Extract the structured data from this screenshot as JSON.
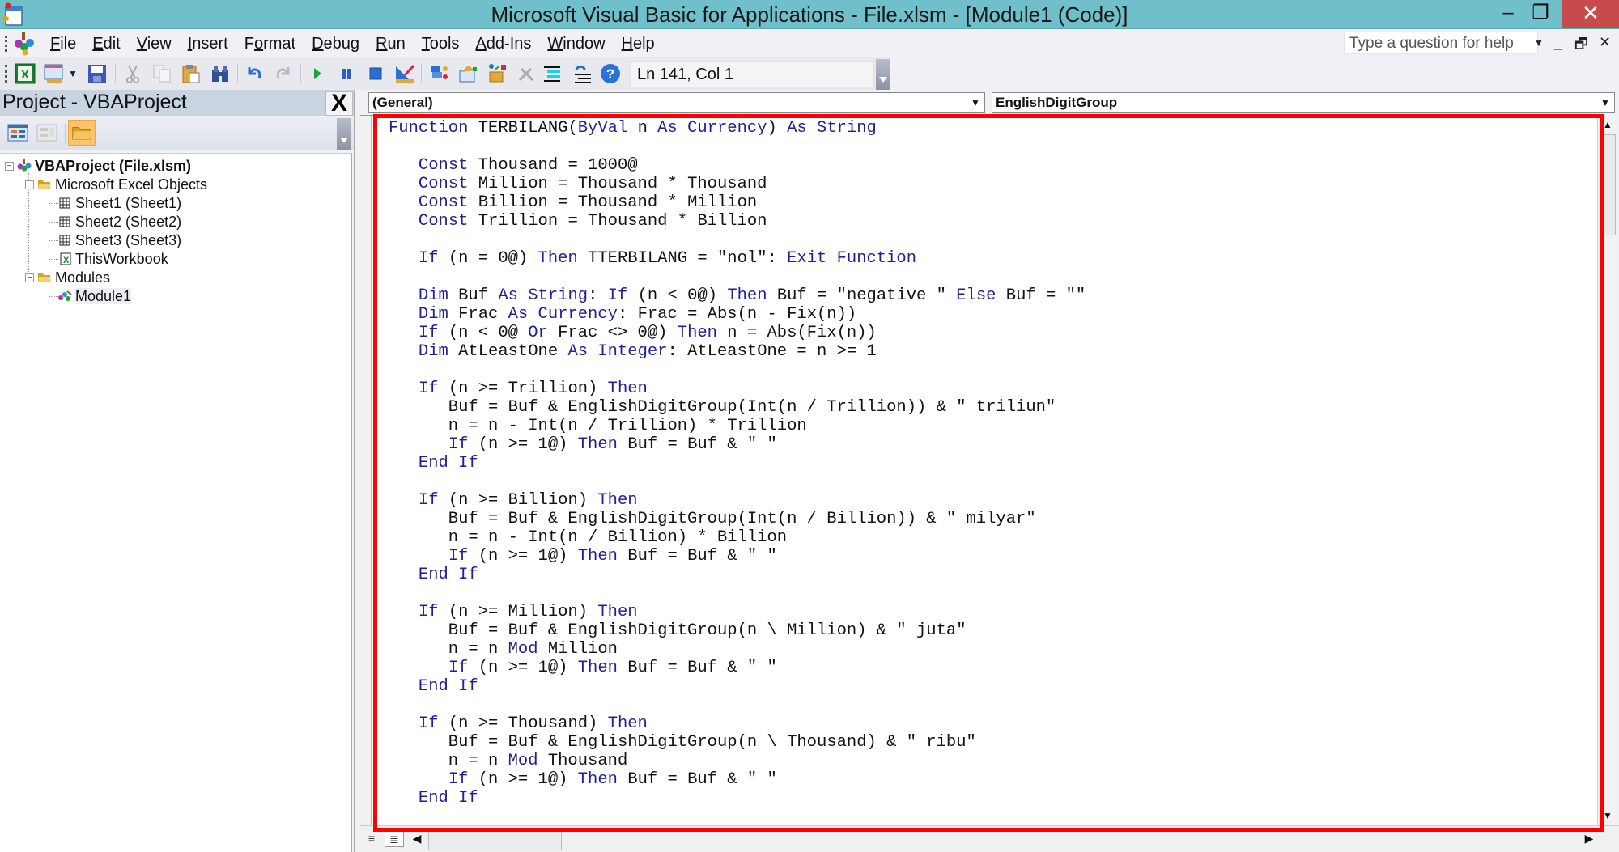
{
  "window": {
    "title": "Microsoft Visual Basic for Applications - File.xlsm - [Module1 (Code)]",
    "controls": {
      "minimize": "–",
      "maximize": "❐",
      "close": "✕"
    }
  },
  "menubar": {
    "items": [
      {
        "pre": "",
        "ul": "F",
        "post": "ile"
      },
      {
        "pre": "",
        "ul": "E",
        "post": "dit"
      },
      {
        "pre": "",
        "ul": "V",
        "post": "iew"
      },
      {
        "pre": "",
        "ul": "I",
        "post": "nsert"
      },
      {
        "pre": "F",
        "ul": "o",
        "post": "rmat"
      },
      {
        "pre": "",
        "ul": "D",
        "post": "ebug"
      },
      {
        "pre": "",
        "ul": "R",
        "post": "un"
      },
      {
        "pre": "",
        "ul": "T",
        "post": "ools"
      },
      {
        "pre": "",
        "ul": "A",
        "post": "dd-Ins"
      },
      {
        "pre": "",
        "ul": "W",
        "post": "indow"
      },
      {
        "pre": "",
        "ul": "H",
        "post": "elp"
      }
    ],
    "help_placeholder": "Type a question for help",
    "mdi": {
      "minimize": "_",
      "restore": "🗗",
      "close": "✕"
    }
  },
  "toolbar": {
    "buttons": [
      "view-excel",
      "insert-userform",
      "insert-dropdown",
      "save",
      "cut",
      "copy",
      "paste",
      "find",
      "undo",
      "redo",
      "run",
      "break",
      "reset",
      "design-mode",
      "project-explorer",
      "properties-window",
      "object-browser",
      "toolbox",
      "indent",
      "outdent",
      "help"
    ],
    "cursor_position": "Ln 141, Col 1"
  },
  "project_pane": {
    "title": "Project - VBAProject",
    "close_label": "X",
    "buttons": [
      "view-code",
      "view-object",
      "toggle-folders"
    ],
    "tree": [
      {
        "label": "VBAProject (File.xlsm)",
        "level": 0,
        "icon": "project",
        "bold": true
      },
      {
        "label": "Microsoft Excel Objects",
        "level": 1,
        "icon": "folder"
      },
      {
        "label": "Sheet1 (Sheet1)",
        "level": 2,
        "icon": "sheet"
      },
      {
        "label": "Sheet2 (Sheet2)",
        "level": 2,
        "icon": "sheet"
      },
      {
        "label": "Sheet3 (Sheet3)",
        "level": 2,
        "icon": "sheet"
      },
      {
        "label": "ThisWorkbook",
        "level": 2,
        "icon": "workbook"
      },
      {
        "label": "Modules",
        "level": 1,
        "icon": "folder"
      },
      {
        "label": "Module1",
        "level": 2,
        "icon": "module",
        "selected": true
      }
    ]
  },
  "code_pane": {
    "object_combo": "(General)",
    "procedure_combo": "EnglishDigitGroup",
    "highlight_color": "#ff0000",
    "keyword_color": "#1f1f9c",
    "lines": [
      [
        [
          "k",
          "Function"
        ],
        [
          "t",
          " TERBILANG("
        ],
        [
          "k",
          "ByVal"
        ],
        [
          "t",
          " n "
        ],
        [
          "k",
          "As"
        ],
        [
          "t",
          " "
        ],
        [
          "k",
          "Currency"
        ],
        [
          "t",
          ") "
        ],
        [
          "k",
          "As"
        ],
        [
          "t",
          " "
        ],
        [
          "k",
          "String"
        ]
      ],
      [],
      [
        [
          "t",
          "   "
        ],
        [
          "k",
          "Const"
        ],
        [
          "t",
          " Thousand = 1000@"
        ]
      ],
      [
        [
          "t",
          "   "
        ],
        [
          "k",
          "Const"
        ],
        [
          "t",
          " Million = Thousand * Thousand"
        ]
      ],
      [
        [
          "t",
          "   "
        ],
        [
          "k",
          "Const"
        ],
        [
          "t",
          " Billion = Thousand * Million"
        ]
      ],
      [
        [
          "t",
          "   "
        ],
        [
          "k",
          "Const"
        ],
        [
          "t",
          " Trillion = Thousand * Billion"
        ]
      ],
      [],
      [
        [
          "t",
          "   "
        ],
        [
          "k",
          "If"
        ],
        [
          "t",
          " (n = 0@) "
        ],
        [
          "k",
          "Then"
        ],
        [
          "t",
          " TTERBILANG = \"nol\": "
        ],
        [
          "k",
          "Exit Function"
        ]
      ],
      [],
      [
        [
          "t",
          "   "
        ],
        [
          "k",
          "Dim"
        ],
        [
          "t",
          " Buf "
        ],
        [
          "k",
          "As"
        ],
        [
          "t",
          " "
        ],
        [
          "k",
          "String"
        ],
        [
          "t",
          ": "
        ],
        [
          "k",
          "If"
        ],
        [
          "t",
          " (n < 0@) "
        ],
        [
          "k",
          "Then"
        ],
        [
          "t",
          " Buf = \"negative \" "
        ],
        [
          "k",
          "Else"
        ],
        [
          "t",
          " Buf = \"\""
        ]
      ],
      [
        [
          "t",
          "   "
        ],
        [
          "k",
          "Dim"
        ],
        [
          "t",
          " Frac "
        ],
        [
          "k",
          "As"
        ],
        [
          "t",
          " "
        ],
        [
          "k",
          "Currency"
        ],
        [
          "t",
          ": Frac = Abs(n - Fix(n))"
        ]
      ],
      [
        [
          "t",
          "   "
        ],
        [
          "k",
          "If"
        ],
        [
          "t",
          " (n < 0@ "
        ],
        [
          "k",
          "Or"
        ],
        [
          "t",
          " Frac <> 0@) "
        ],
        [
          "k",
          "Then"
        ],
        [
          "t",
          " n = Abs(Fix(n))"
        ]
      ],
      [
        [
          "t",
          "   "
        ],
        [
          "k",
          "Dim"
        ],
        [
          "t",
          " AtLeastOne "
        ],
        [
          "k",
          "As"
        ],
        [
          "t",
          " "
        ],
        [
          "k",
          "Integer"
        ],
        [
          "t",
          ": AtLeastOne = n >= 1"
        ]
      ],
      [],
      [
        [
          "t",
          "   "
        ],
        [
          "k",
          "If"
        ],
        [
          "t",
          " (n >= Trillion) "
        ],
        [
          "k",
          "Then"
        ]
      ],
      [
        [
          "t",
          "      Buf = Buf & EnglishDigitGroup(Int(n / Trillion)) & \" triliun\""
        ]
      ],
      [
        [
          "t",
          "      n = n - Int(n / Trillion) * Trillion"
        ]
      ],
      [
        [
          "t",
          "      "
        ],
        [
          "k",
          "If"
        ],
        [
          "t",
          " (n >= 1@) "
        ],
        [
          "k",
          "Then"
        ],
        [
          "t",
          " Buf = Buf & \" \""
        ]
      ],
      [
        [
          "t",
          "   "
        ],
        [
          "k",
          "End If"
        ]
      ],
      [],
      [
        [
          "t",
          "   "
        ],
        [
          "k",
          "If"
        ],
        [
          "t",
          " (n >= Billion) "
        ],
        [
          "k",
          "Then"
        ]
      ],
      [
        [
          "t",
          "      Buf = Buf & EnglishDigitGroup(Int(n / Billion)) & \" milyar\""
        ]
      ],
      [
        [
          "t",
          "      n = n - Int(n / Billion) * Billion"
        ]
      ],
      [
        [
          "t",
          "      "
        ],
        [
          "k",
          "If"
        ],
        [
          "t",
          " (n >= 1@) "
        ],
        [
          "k",
          "Then"
        ],
        [
          "t",
          " Buf = Buf & \" \""
        ]
      ],
      [
        [
          "t",
          "   "
        ],
        [
          "k",
          "End If"
        ]
      ],
      [],
      [
        [
          "t",
          "   "
        ],
        [
          "k",
          "If"
        ],
        [
          "t",
          " (n >= Million) "
        ],
        [
          "k",
          "Then"
        ]
      ],
      [
        [
          "t",
          "      Buf = Buf & EnglishDigitGroup(n \\ Million) & \" juta\""
        ]
      ],
      [
        [
          "t",
          "      n = n "
        ],
        [
          "k",
          "Mod"
        ],
        [
          "t",
          " Million"
        ]
      ],
      [
        [
          "t",
          "      "
        ],
        [
          "k",
          "If"
        ],
        [
          "t",
          " (n >= 1@) "
        ],
        [
          "k",
          "Then"
        ],
        [
          "t",
          " Buf = Buf & \" \""
        ]
      ],
      [
        [
          "t",
          "   "
        ],
        [
          "k",
          "End If"
        ]
      ],
      [],
      [
        [
          "t",
          "   "
        ],
        [
          "k",
          "If"
        ],
        [
          "t",
          " (n >= Thousand) "
        ],
        [
          "k",
          "Then"
        ]
      ],
      [
        [
          "t",
          "      Buf = Buf & EnglishDigitGroup(n \\ Thousand) & \" ribu\""
        ]
      ],
      [
        [
          "t",
          "      n = n "
        ],
        [
          "k",
          "Mod"
        ],
        [
          "t",
          " Thousand"
        ]
      ],
      [
        [
          "t",
          "      "
        ],
        [
          "k",
          "If"
        ],
        [
          "t",
          " (n >= 1@) "
        ],
        [
          "k",
          "Then"
        ],
        [
          "t",
          " Buf = Buf & \" \""
        ]
      ],
      [
        [
          "t",
          "   "
        ],
        [
          "k",
          "End If"
        ]
      ]
    ]
  }
}
